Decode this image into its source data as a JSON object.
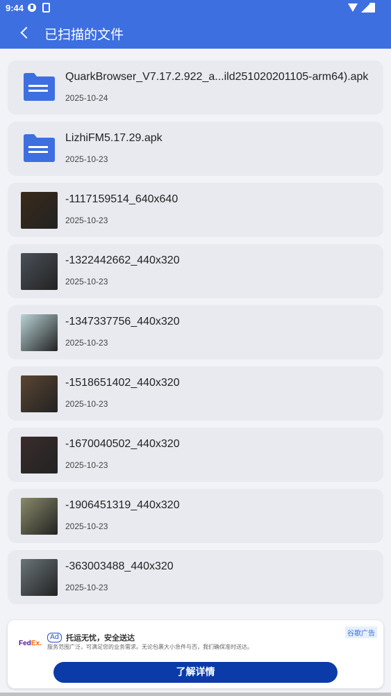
{
  "status_bar": {
    "time": "9:44"
  },
  "header": {
    "title": "已扫描的文件"
  },
  "files": [
    {
      "name": "QuarkBrowser_V7.17.2.922_a...ild251020201105-arm64).apk",
      "date": "2025-10-24",
      "type": "folder-icon"
    },
    {
      "name": "LizhiFM5.17.29.apk",
      "date": "2025-10-23",
      "type": "folder-icon"
    },
    {
      "name": "-1117159514_640x640",
      "date": "2025-10-23",
      "type": "image",
      "thumb_color": "#3a2a1a"
    },
    {
      "name": "-1322442662_440x320",
      "date": "2025-10-23",
      "type": "image",
      "thumb_color": "#4a5058"
    },
    {
      "name": "-1347337756_440x320",
      "date": "2025-10-23",
      "type": "image",
      "thumb_color": "#b9d3d6"
    },
    {
      "name": "-1518651402_440x320",
      "date": "2025-10-23",
      "type": "image",
      "thumb_color": "#5a4632"
    },
    {
      "name": "-1670040502_440x320",
      "date": "2025-10-23",
      "type": "image",
      "thumb_color": "#3a2c2c"
    },
    {
      "name": "-1906451319_440x320",
      "date": "2025-10-23",
      "type": "image",
      "thumb_color": "#8a8a6a"
    },
    {
      "name": "-363003488_440x320",
      "date": "2025-10-23",
      "type": "image",
      "thumb_color": "#6a7478"
    }
  ],
  "ad": {
    "logo_part1": "Fed",
    "logo_part2": "Ex.",
    "badge": "Ad",
    "title": "托运无忧，安全送达",
    "description": "服务范围广泛，可满足您的业务需求。无论包裹大小急件与否，我们确保准时送达。",
    "corner_label": "谷歌广告",
    "cta": "了解详情"
  },
  "colors": {
    "accent": "#3d6fe0",
    "cta": "#0a3ba8",
    "folder": "#3d6fe0"
  }
}
